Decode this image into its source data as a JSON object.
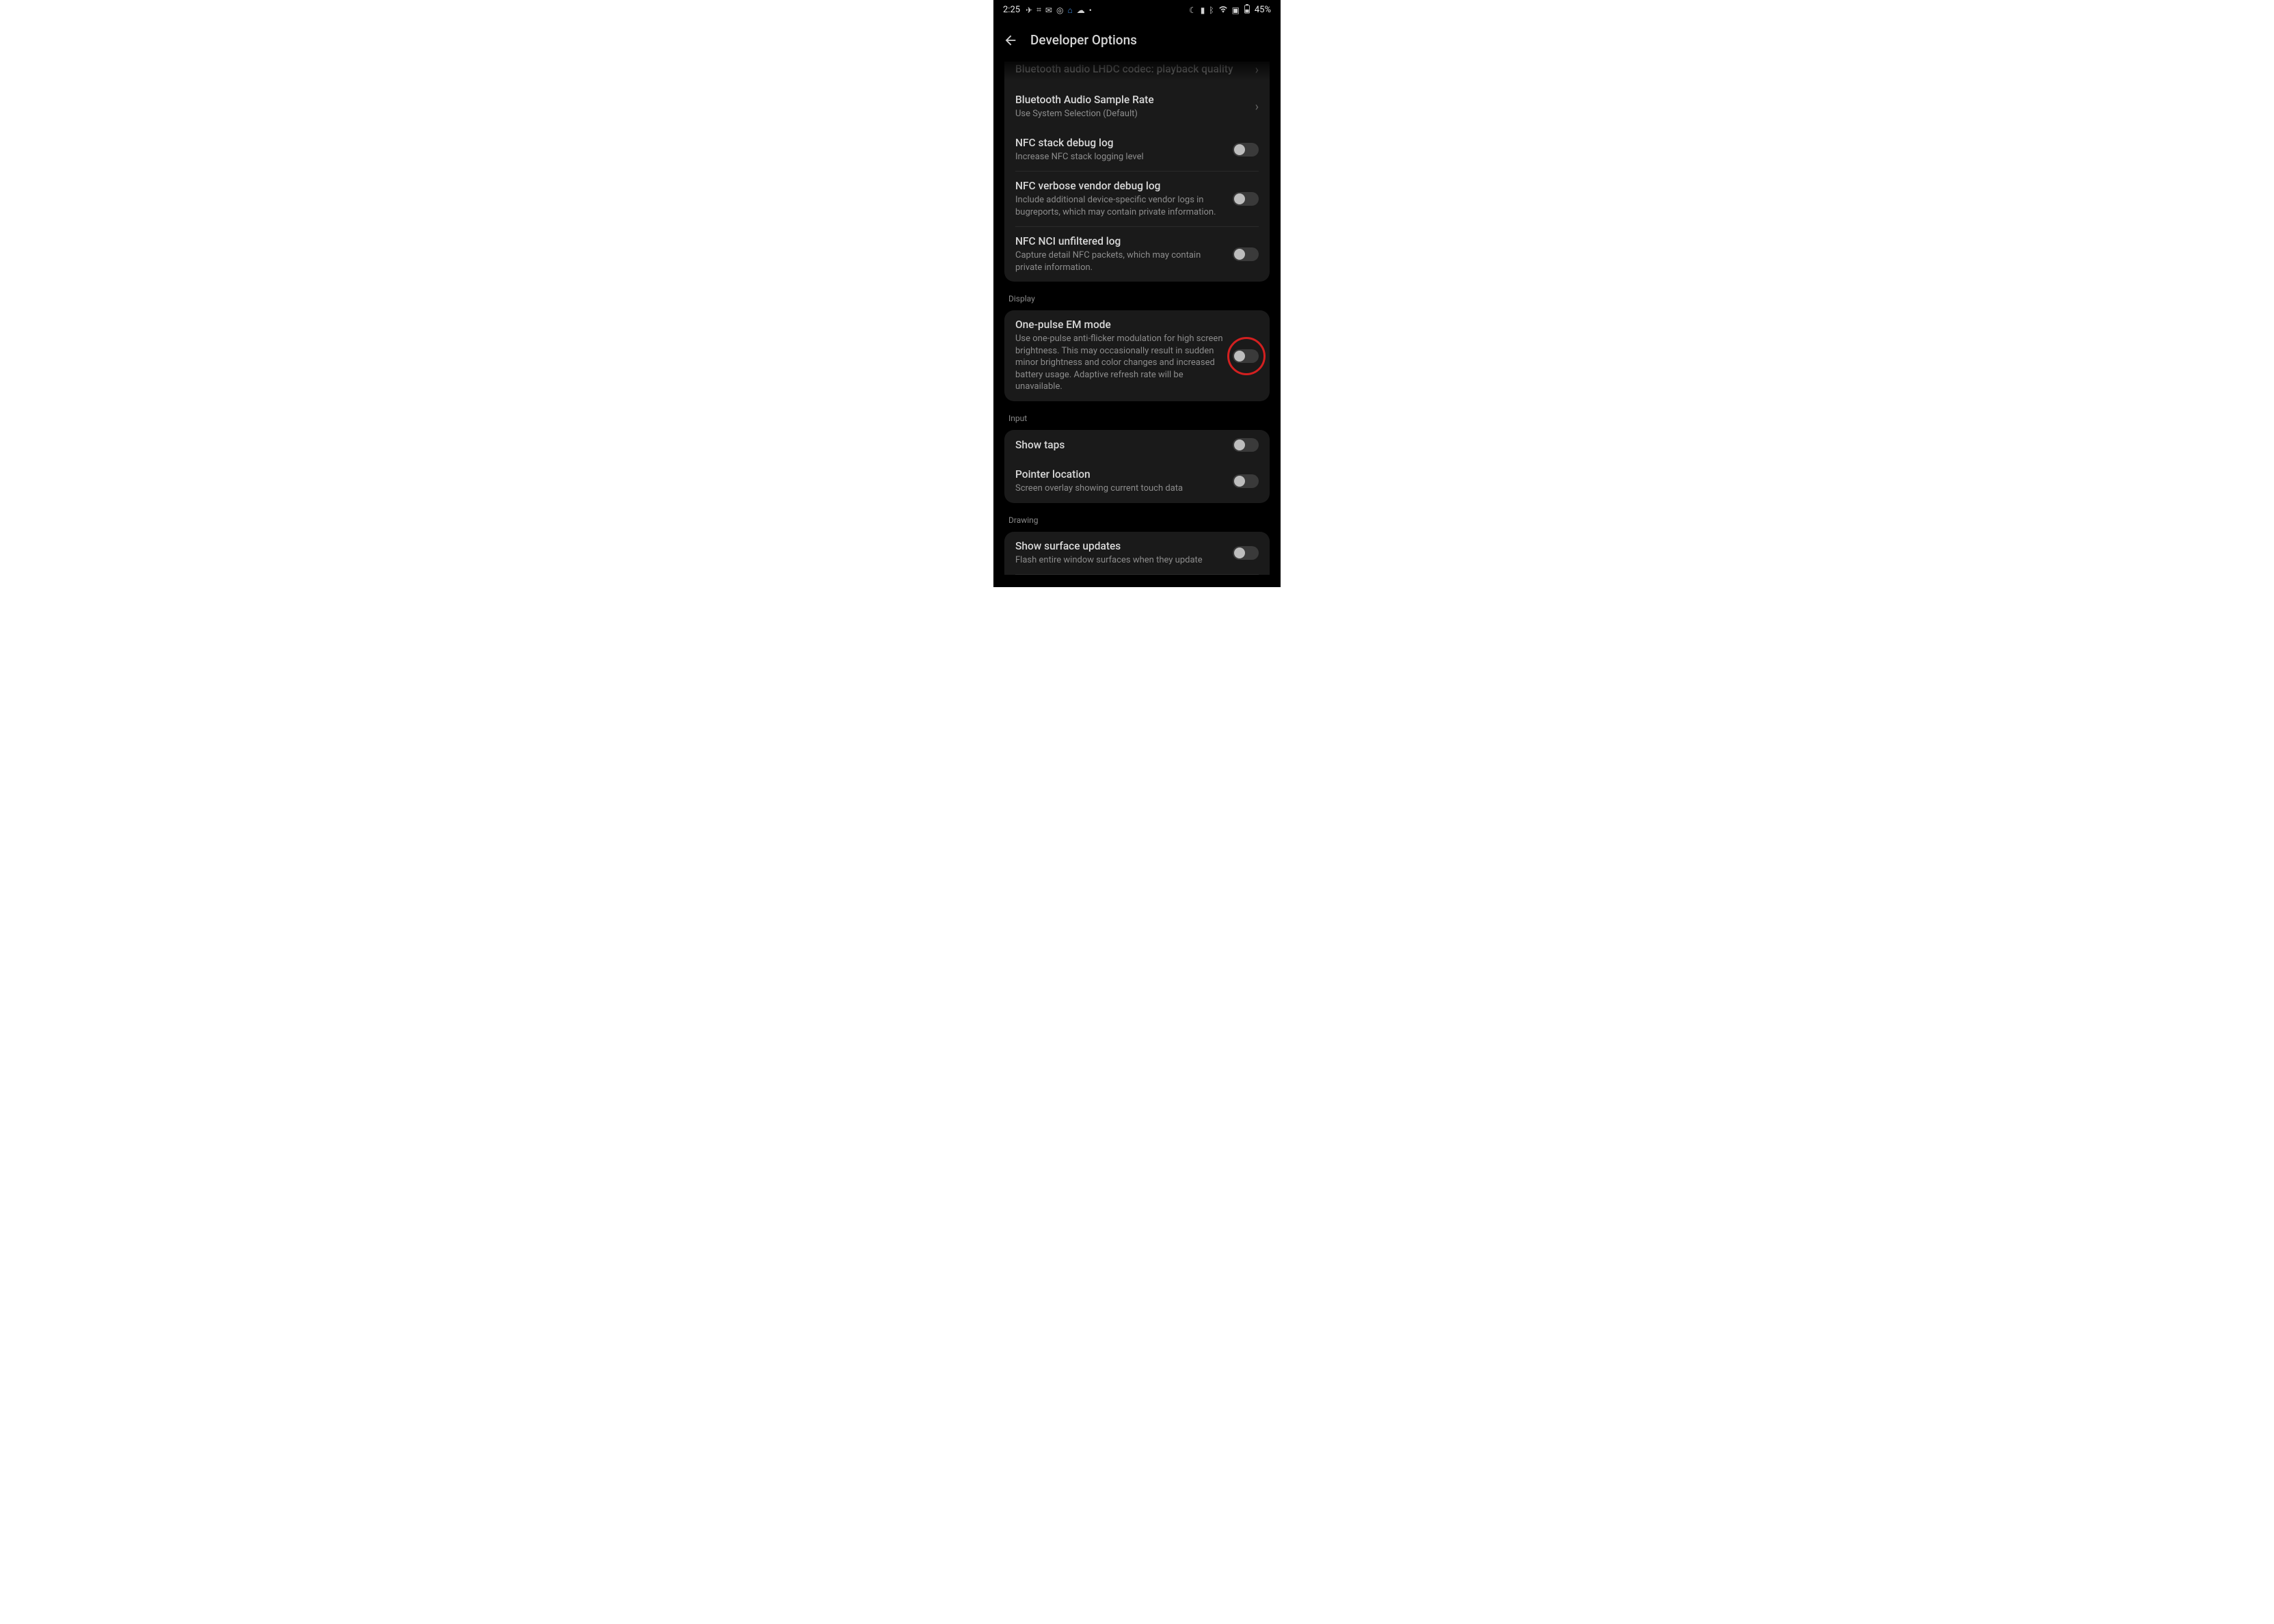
{
  "status": {
    "time": "2:25",
    "left_icons": [
      "send-icon",
      "grid-icon",
      "mail-icon",
      "instagram-icon",
      "home-icon",
      "cloud-icon",
      "dot-icon"
    ],
    "right_icons": [
      "moon-icon",
      "vibrate-icon",
      "bluetooth-icon",
      "wifi-icon",
      "cast-icon"
    ],
    "battery_text": "45%"
  },
  "appbar": {
    "title": "Developer Options"
  },
  "groups": [
    {
      "header": null,
      "cutoff_top": true,
      "rows": [
        {
          "title": "Bluetooth audio LHDC codec: playback quality",
          "sub": null,
          "type": "chevron",
          "dim": true
        },
        {
          "title": "Bluetooth Audio Sample Rate",
          "sub": "Use System Selection (Default)",
          "type": "chevron"
        },
        {
          "title": "NFC stack debug log",
          "sub": "Increase NFC stack logging level",
          "type": "toggle"
        },
        {
          "title": "NFC verbose vendor debug log",
          "sub": "Include additional device-specific vendor logs in bugreports, which may contain private information.",
          "type": "toggle"
        },
        {
          "title": "NFC NCI unfiltered log",
          "sub": "Capture detail NFC packets, which may contain private information.",
          "type": "toggle"
        }
      ]
    },
    {
      "header": "Display",
      "rows": [
        {
          "title": "One-pulse EM mode",
          "sub": "Use one-pulse anti-flicker modulation for high screen brightness. This may occasionally result in sudden minor brightness and color changes and increased battery usage. Adaptive refresh rate will be unavailable.",
          "type": "toggle",
          "highlighted": true
        }
      ]
    },
    {
      "header": "Input",
      "rows": [
        {
          "title": "Show taps",
          "sub": null,
          "type": "toggle"
        },
        {
          "title": "Pointer location",
          "sub": "Screen overlay showing current touch data",
          "type": "toggle"
        }
      ]
    },
    {
      "header": "Drawing",
      "cutoff_bottom": true,
      "rows": [
        {
          "title": "Show surface updates",
          "sub": "Flash entire window surfaces when they update",
          "type": "toggle"
        }
      ]
    }
  ]
}
